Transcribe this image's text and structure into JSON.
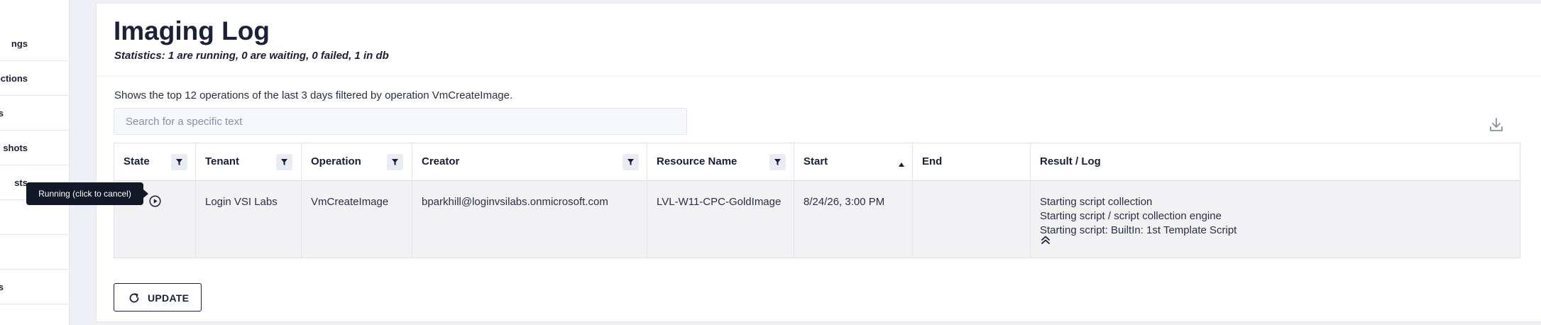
{
  "sidebar": {
    "items": [
      {
        "label": "ngs"
      },
      {
        "label": "ections"
      },
      {
        "label": "s"
      },
      {
        "label": "shots"
      },
      {
        "label": "sts"
      },
      {
        "label": ""
      },
      {
        "label": ""
      },
      {
        "label": "s"
      }
    ]
  },
  "page": {
    "title": "Imaging Log",
    "statistics": "Statistics: 1 are running, 0 are waiting, 0 failed, 1 in db",
    "description": "Shows the top 12 operations of the last 3 days filtered by operation VmCreateImage."
  },
  "search": {
    "placeholder": "Search for a specific text",
    "value": ""
  },
  "table": {
    "columns": [
      {
        "label": "State",
        "filter": true
      },
      {
        "label": "Tenant",
        "filter": true
      },
      {
        "label": "Operation",
        "filter": true
      },
      {
        "label": "Creator",
        "filter": true
      },
      {
        "label": "Resource Name",
        "filter": true
      },
      {
        "label": "Start",
        "sort": "ascending"
      },
      {
        "label": "End"
      },
      {
        "label": "Result / Log"
      }
    ],
    "rows": [
      {
        "state": "running",
        "tenant": "Login VSI Labs",
        "operation": "VmCreateImage",
        "creator": "bparkhill@loginvsilabs.onmicrosoft.com",
        "resource_name": "LVL-W11-CPC-GoldImage",
        "start": "8/24/26, 3:00 PM",
        "end": "",
        "log": [
          "Starting script collection",
          "Starting script / script collection engine",
          "Starting script: BuiltIn: 1st Template Script"
        ]
      }
    ]
  },
  "tooltip": "Running (click to cancel)",
  "update_button": "UPDATE",
  "icons": {
    "download": "download-icon",
    "filter": "filter-icon",
    "sort": "sort-ascending-icon",
    "running": "running-state-icon",
    "collapse": "chevron-double-up-icon",
    "refresh": "refresh-icon"
  },
  "colors": {
    "title": "#1a2138",
    "tooltip_bg": "#111827",
    "row_bg": "#f2f2f4"
  }
}
